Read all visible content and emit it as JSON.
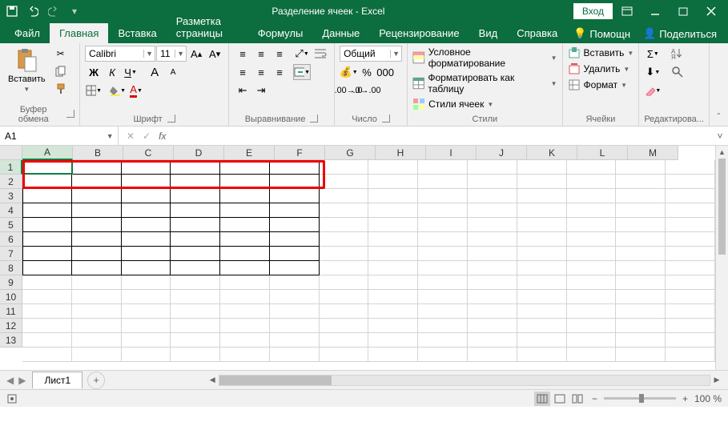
{
  "titlebar": {
    "title": "Разделение ячеек  -  Excel",
    "login": "Вход"
  },
  "tabs": {
    "file": "Файл",
    "home": "Главная",
    "insert": "Вставка",
    "layout": "Разметка страницы",
    "formulas": "Формулы",
    "data": "Данные",
    "review": "Рецензирование",
    "view": "Вид",
    "help": "Справка",
    "tellme": "Помощн",
    "share": "Поделиться"
  },
  "ribbon": {
    "clipboard": {
      "paste": "Вставить",
      "label": "Буфер обмена"
    },
    "font": {
      "name": "Calibri",
      "size": "11",
      "label": "Шрифт"
    },
    "alignment": {
      "label": "Выравнивание"
    },
    "number": {
      "format": "Общий",
      "label": "Число"
    },
    "styles": {
      "conditional": "Условное форматирование",
      "table": "Форматировать как таблицу",
      "cell": "Стили ячеек",
      "label": "Стили"
    },
    "cells": {
      "insert": "Вставить",
      "delete": "Удалить",
      "format": "Формат",
      "label": "Ячейки"
    },
    "editing": {
      "label": "Редактирова..."
    }
  },
  "namebox": {
    "value": "A1"
  },
  "columns": [
    "A",
    "B",
    "C",
    "D",
    "E",
    "F",
    "G",
    "H",
    "I",
    "J",
    "K",
    "L",
    "M"
  ],
  "rows": [
    "1",
    "2",
    "3",
    "4",
    "5",
    "6",
    "7",
    "8",
    "9",
    "10",
    "11",
    "12",
    "13"
  ],
  "sheet": {
    "name": "Лист1"
  },
  "status": {
    "ready": "",
    "zoom": "100 %"
  }
}
